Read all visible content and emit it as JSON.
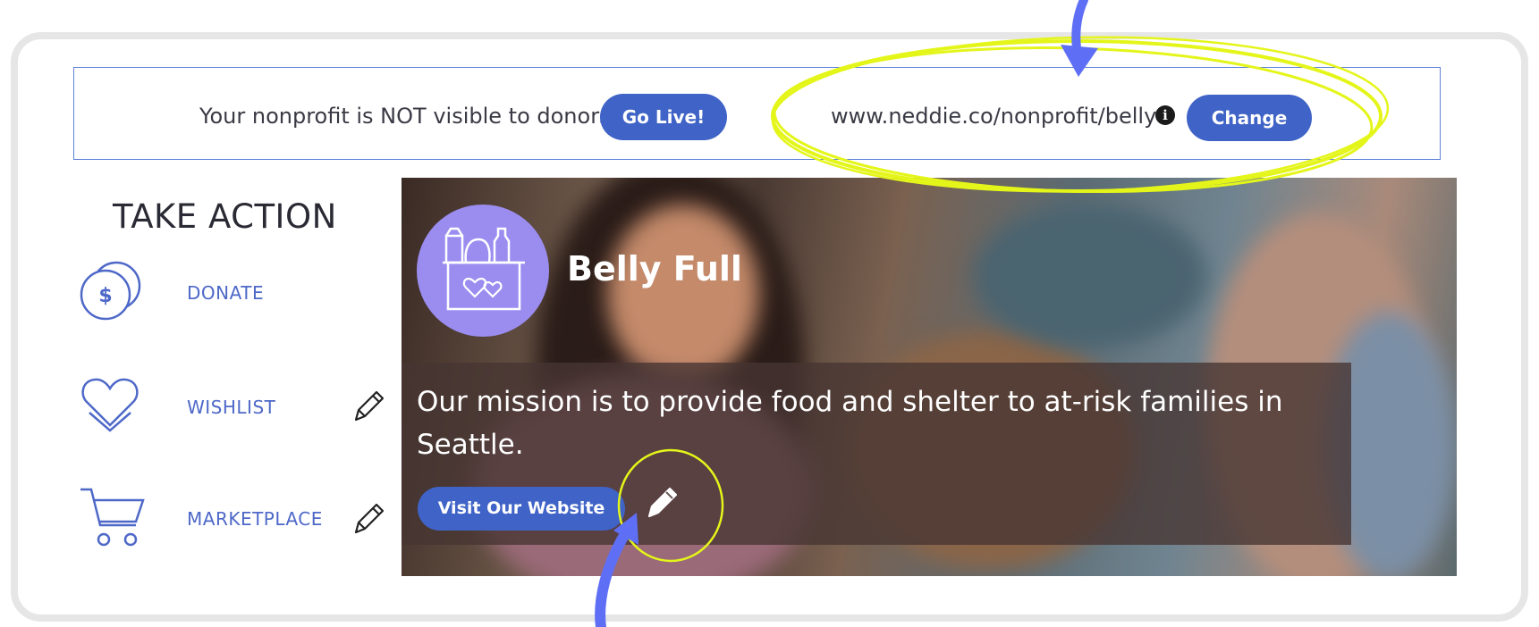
{
  "status_bar": {
    "visibility_text": "Your nonprofit is NOT visible to donors",
    "go_live_label": "Go Live!",
    "url": "www.neddie.co/nonprofit/belly",
    "change_label": "Change"
  },
  "sidebar": {
    "title": "TAKE ACTION",
    "items": [
      {
        "label": "DONATE",
        "icon": "donate-coins-icon",
        "editable": false
      },
      {
        "label": "WISHLIST",
        "icon": "heart-icon",
        "editable": true
      },
      {
        "label": "MARKETPLACE",
        "icon": "cart-icon",
        "editable": true
      }
    ]
  },
  "hero": {
    "org_name": "Belly Full",
    "logo_icon": "grocery-box-heart-icon",
    "mission": "Our mission is to provide food and shelter to at-risk families in Seattle.",
    "visit_label": "Visit Our Website"
  },
  "colors": {
    "accent": "#3f63c6",
    "border": "#5f82d8",
    "link": "#4e68c8",
    "logo_bg": "#9b8df0",
    "highlight": "#e4f51a",
    "arrow": "#5f6ff5"
  }
}
